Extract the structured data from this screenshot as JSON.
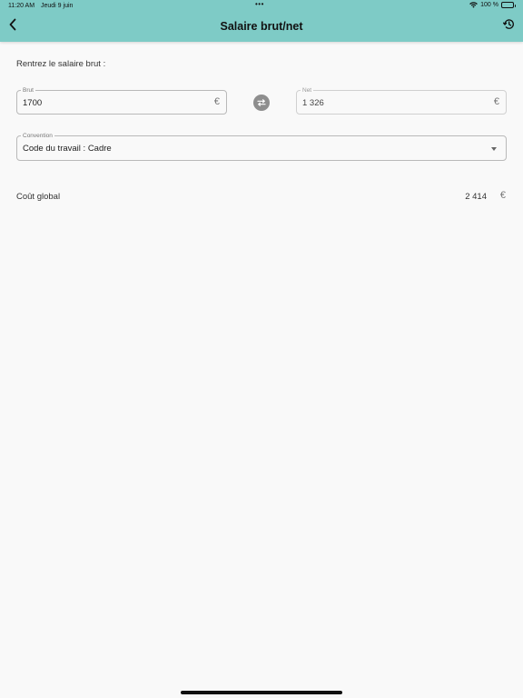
{
  "status_bar": {
    "time": "11:20 AM",
    "date": "Jeudi 9 juin",
    "dots": "•••",
    "battery": "100 %"
  },
  "header": {
    "title": "Salaire brut/net",
    "back_icon": "chevron-left-icon",
    "history_icon": "history-icon",
    "background_color": "#7ecbc6"
  },
  "form": {
    "instruction": "Rentrez le salaire brut :",
    "brut": {
      "label": "Brut",
      "value": "1700",
      "currency": "€"
    },
    "net": {
      "label": "Net",
      "value": "1 326",
      "currency": "€"
    },
    "swap_icon": "swap-arrows-icon",
    "convention": {
      "label": "Convention",
      "value": "Code du travail : Cadre"
    }
  },
  "result": {
    "label": "Coût global",
    "value": "2 414",
    "currency": "€"
  }
}
